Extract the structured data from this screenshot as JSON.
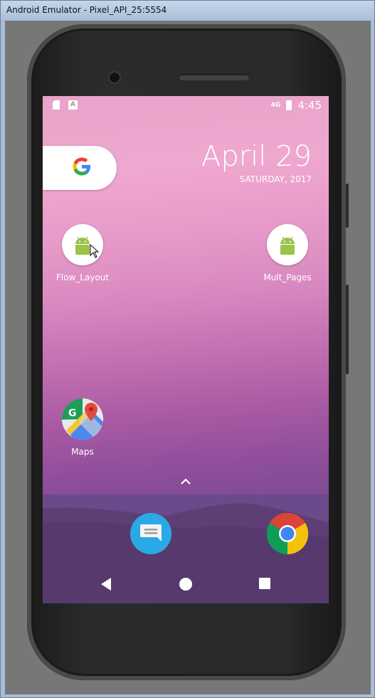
{
  "window": {
    "title": "Android Emulator - Pixel_API_25:5554"
  },
  "status_bar": {
    "network": "4G",
    "time": "4:45"
  },
  "clock_widget": {
    "date": "April 29",
    "day": "SATURDAY, 2017"
  },
  "apps": [
    {
      "label": "Flow_Layout",
      "icon": "android-icon"
    },
    {
      "label": "Mult_Pages",
      "icon": "android-icon"
    },
    {
      "label": "Maps",
      "icon": "maps-icon"
    }
  ],
  "dock": [
    {
      "icon": "messages-icon"
    },
    {
      "icon": "chrome-icon"
    }
  ],
  "colors": {
    "android_green": "#9bc24a",
    "messages_blue": "#2aa9e6"
  }
}
